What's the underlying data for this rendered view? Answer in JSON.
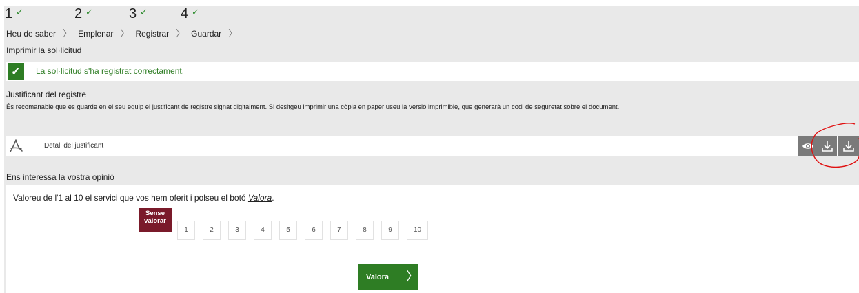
{
  "steps": [
    {
      "number": "1",
      "done": true
    },
    {
      "number": "2",
      "done": true
    },
    {
      "number": "3",
      "done": true
    },
    {
      "number": "4",
      "done": true
    }
  ],
  "breadcrumb": [
    "Heu de saber",
    "Emplenar",
    "Registrar",
    "Guardar"
  ],
  "breadcrumb_separator": "〉",
  "check_glyph": "✓",
  "print_section": {
    "title": "Imprimir la sol·licitud",
    "success_message": "La sol·licitud s'ha registrat correctament."
  },
  "receipt": {
    "title": "Justificant del registre",
    "description": "És recomanable que es guarde en el seu equip el justificant de registre signat digitalment. Si desitgeu imprimir una còpia en paper useu la versió imprimible, que generarà un codi de seguretat sobre el document.",
    "document_label": "Detall del justificant",
    "actions": [
      "eye-icon",
      "download-icon",
      "download-icon"
    ]
  },
  "feedback": {
    "title": "Ens interessa la vostra opinió",
    "prompt_before": "Valoreu de l'1 al 10 el servici que vos hem oferit i polseu el botó ",
    "prompt_link": "Valora",
    "prompt_after": ".",
    "no_rating_label": "Sense valorar",
    "ratings": [
      "1",
      "2",
      "3",
      "4",
      "5",
      "6",
      "7",
      "8",
      "9",
      "10"
    ],
    "submit_label": "Valora",
    "submit_chevron": "〉"
  },
  "colors": {
    "success_green": "#2e7d24",
    "no_rating_bg": "#7a1a2a",
    "action_gray": "#7a7a7a",
    "annotation_red": "#e01010"
  }
}
